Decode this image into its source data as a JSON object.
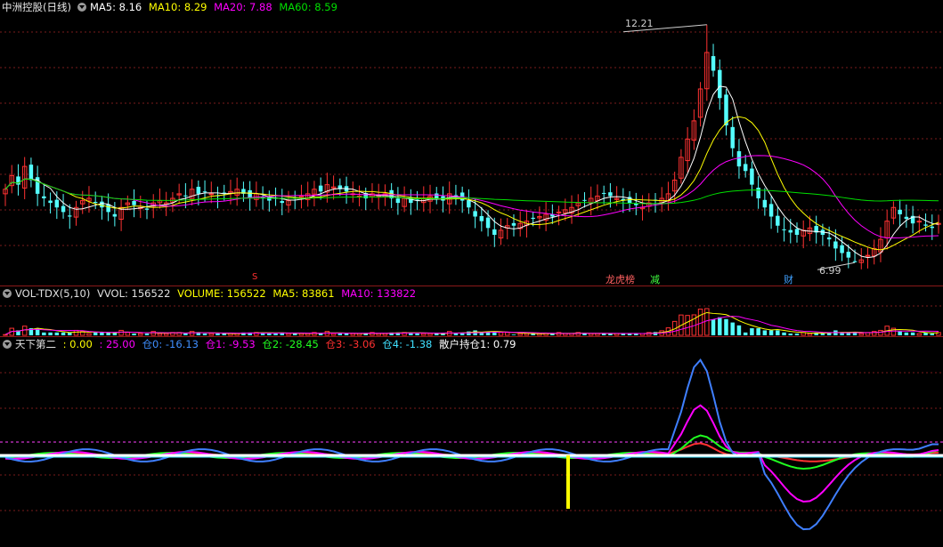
{
  "colors": {
    "bg": "#000000",
    "up": "#ff3232",
    "down": "#54ffff",
    "ma5": "#ffffff",
    "ma10": "#ffff00",
    "ma20": "#ff00ff",
    "ma60": "#00e000",
    "grid": "#7a1c1c",
    "blue": "#3f7fff",
    "white": "#ffffff"
  },
  "main": {
    "title": "中洲控股(日线)",
    "ma5_label": "MA5: 8.16",
    "ma10_label": "MA10: 8.29",
    "ma20_label": "MA20: 7.88",
    "ma60_label": "MA60: 8.59",
    "high_label": "12.21",
    "low_label": "6.99",
    "marker_s": "S",
    "marker_list": "龙虎榜",
    "marker_reduce": "减",
    "marker_fin": "财"
  },
  "vol": {
    "name": "VOL-TDX(5,10)",
    "vvol": "VVOL: 156522",
    "volume": "VOLUME: 156522",
    "ma5": "MA5: 83861",
    "ma10": "MA10: 133822"
  },
  "ind": {
    "name": "天下第二",
    "v0": ": 0.00",
    "v1": ": 25.00",
    "c0": "仓0: -16.13",
    "c1": "仓1: -9.53",
    "c2": "仓2: -28.45",
    "c3": "仓3: -3.06",
    "c4": "仓4: -1.38",
    "retail": "散户持仓1: 0.79"
  },
  "series": {
    "close": [
      8.6,
      8.9,
      8.7,
      9.1,
      8.8,
      8.5,
      8.4,
      8.3,
      8.2,
      8.1,
      8.0,
      8.2,
      8.35,
      8.4,
      8.3,
      8.2,
      8.1,
      8.0,
      8.2,
      8.3,
      8.25,
      8.2,
      8.15,
      8.3,
      8.35,
      8.3,
      8.4,
      8.5,
      8.45,
      8.6,
      8.5,
      8.55,
      8.5,
      8.45,
      8.5,
      8.55,
      8.6,
      8.5,
      8.4,
      8.5,
      8.4,
      8.35,
      8.4,
      8.3,
      8.35,
      8.4,
      8.45,
      8.5,
      8.6,
      8.55,
      8.7,
      8.65,
      8.6,
      8.55,
      8.5,
      8.45,
      8.4,
      8.5,
      8.45,
      8.5,
      8.4,
      8.3,
      8.4,
      8.3,
      8.35,
      8.4,
      8.45,
      8.4,
      8.35,
      8.5,
      8.45,
      8.35,
      8.2,
      8.0,
      7.9,
      7.75,
      7.6,
      7.7,
      7.8,
      7.8,
      7.85,
      7.9,
      7.95,
      8.0,
      8.05,
      8.0,
      8.1,
      8.15,
      8.2,
      8.3,
      8.35,
      8.4,
      8.45,
      8.5,
      8.45,
      8.4,
      8.35,
      8.3,
      8.25,
      8.2,
      8.3,
      8.35,
      8.4,
      8.5,
      8.8,
      9.3,
      9.7,
      10.1,
      10.8,
      11.6,
      11.2,
      10.6,
      10.0,
      9.5,
      9.1,
      9.0,
      8.7,
      8.4,
      8.2,
      8.0,
      7.8,
      7.7,
      7.65,
      7.6,
      7.7,
      7.75,
      7.65,
      7.6,
      7.5,
      7.3,
      7.2,
      7.1,
      7.0,
      7.05,
      7.15,
      7.3,
      7.5,
      7.9,
      8.2,
      8.05,
      7.95,
      7.85,
      7.9,
      7.8,
      7.75,
      7.85
    ]
  }
}
